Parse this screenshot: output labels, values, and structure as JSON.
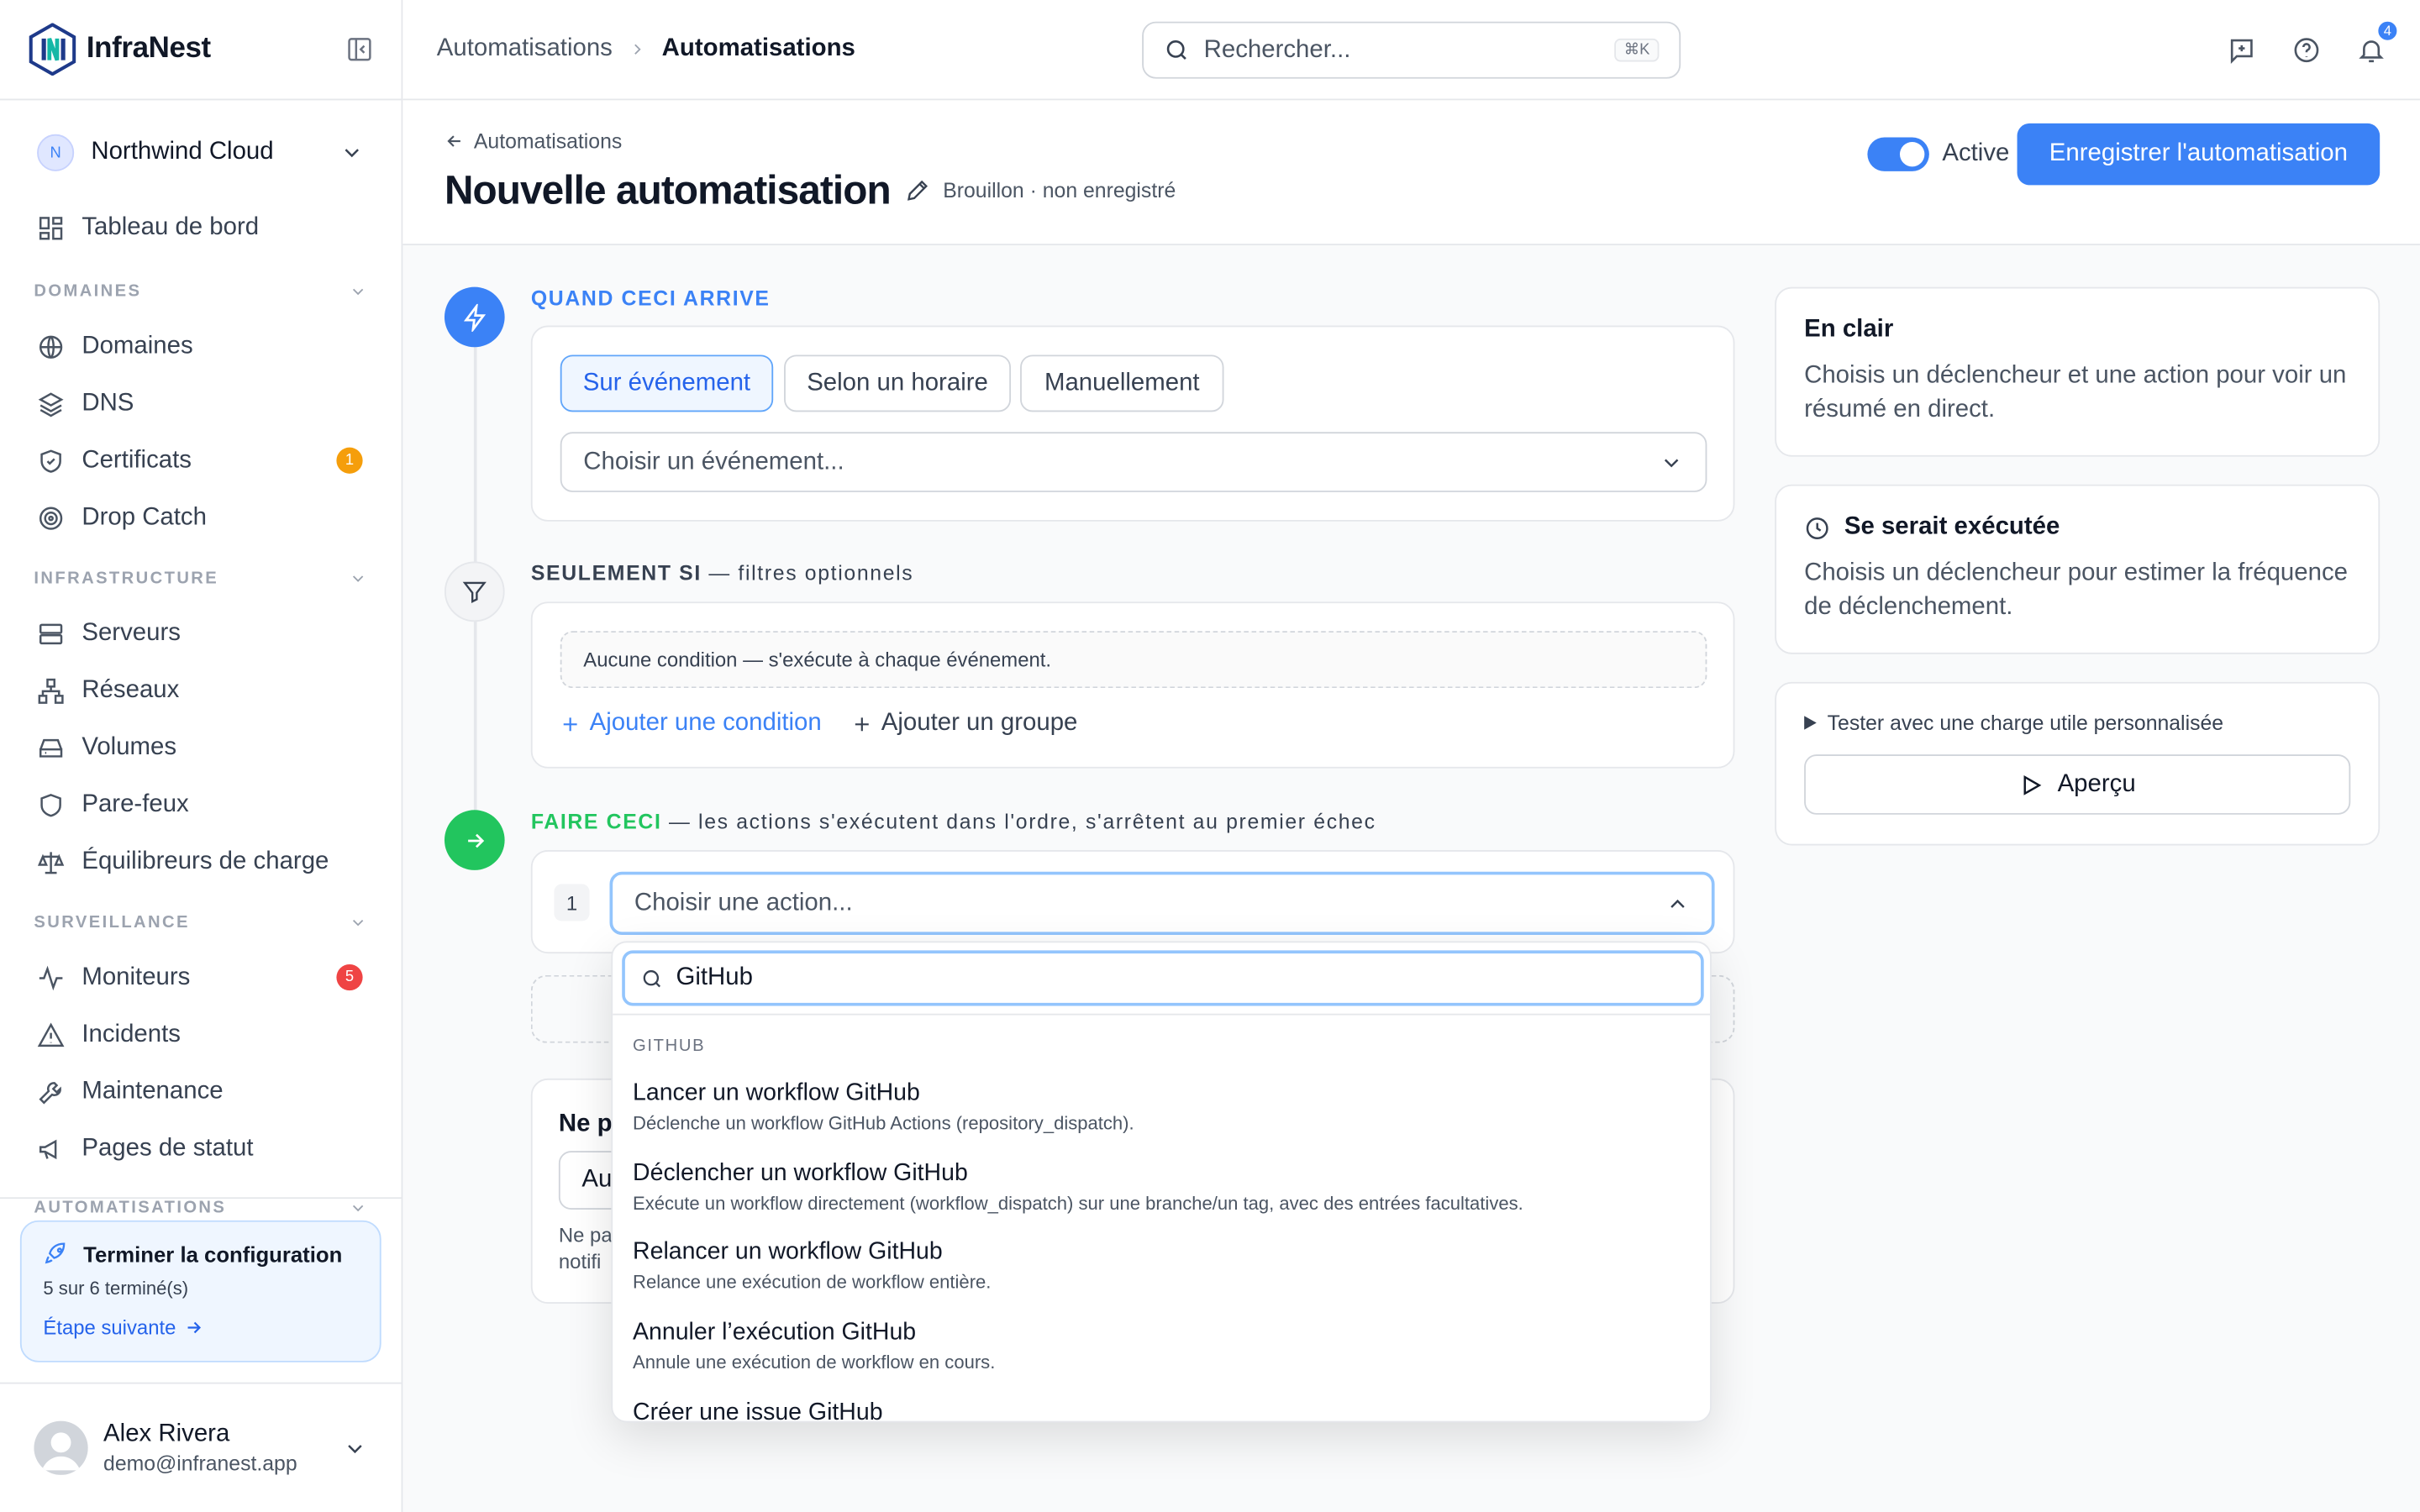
{
  "app": {
    "name": "InfraNest"
  },
  "org": {
    "initial": "N",
    "name": "Northwind Cloud"
  },
  "sidebar": {
    "dashboard": "Tableau de bord",
    "sections": {
      "domains": "DOMAINES",
      "infrastructure": "INFRASTRUCTURE",
      "monitoring": "SURVEILLANCE",
      "automations": "AUTOMATISATIONS"
    },
    "items": {
      "domains": "Domaines",
      "dns": "DNS",
      "certificates": "Certificats",
      "certificates_badge": "1",
      "drop_catch": "Drop Catch",
      "servers": "Serveurs",
      "networks": "Réseaux",
      "volumes": "Volumes",
      "firewalls": "Pare-feux",
      "load_balancers": "Équilibreurs de charge",
      "monitors": "Moniteurs",
      "monitors_badge": "5",
      "incidents": "Incidents",
      "maintenance": "Maintenance",
      "status_pages": "Pages de statut"
    },
    "badge_colors": {
      "certificates": "#f59e0b",
      "monitors": "#ef4444"
    }
  },
  "setup": {
    "title": "Terminer la configuration",
    "progress": "5 sur 6 terminé(s)",
    "next": "Étape suivante"
  },
  "user": {
    "name": "Alex Rivera",
    "email": "demo@infranest.app"
  },
  "topbar": {
    "breadcrumb_parent": "Automatisations",
    "breadcrumb_current": "Automatisations",
    "search_placeholder": "Rechercher...",
    "search_shortcut": "⌘K",
    "notifications_count": "4"
  },
  "header": {
    "back_label": "Automatisations",
    "title": "Nouvelle automatisation",
    "status": "Brouillon · non enregistré",
    "active_label": "Active",
    "active": true,
    "save_label": "Enregistrer l'automatisation"
  },
  "trigger": {
    "label": "QUAND CECI ARRIVE",
    "tabs": [
      "Sur événement",
      "Selon un horaire",
      "Manuellement"
    ],
    "active_tab": 0,
    "event_placeholder": "Choisir un événement..."
  },
  "filters": {
    "label_bold": "SEULEMENT SI",
    "label_rest": " — filtres optionnels",
    "empty": "Aucune condition — s'exécute à chaque événement.",
    "add_condition": "Ajouter une condition",
    "add_group": "Ajouter un groupe"
  },
  "actions": {
    "label_bold": "FAIRE CECI",
    "label_rest": " — les actions s'exécutent dans l'ordre, s'arrêtent au premier échec",
    "step_number": "1",
    "action_placeholder": "Choisir une action...",
    "hidden_card_title": "Ne p",
    "hidden_card_select": "Au",
    "hidden_card_text1": "Ne pa",
    "hidden_card_text2": "notifi"
  },
  "dropdown": {
    "search_value": "GitHub",
    "group": "GITHUB",
    "items": [
      {
        "title": "Lancer un workflow GitHub",
        "desc": "Déclenche un workflow GitHub Actions (repository_dispatch)."
      },
      {
        "title": "Déclencher un workflow GitHub",
        "desc": "Exécute un workflow directement (workflow_dispatch) sur une branche/un tag, avec des entrées facultatives."
      },
      {
        "title": "Relancer un workflow GitHub",
        "desc": "Relance une exécution de workflow entière."
      },
      {
        "title": "Annuler l’exécution GitHub",
        "desc": "Annule une exécution de workflow en cours."
      },
      {
        "title": "Créer une issue GitHub",
        "desc": ""
      }
    ]
  },
  "panel": {
    "plain_title": "En clair",
    "plain_text": "Choisis un déclencheur et une action pour voir un résumé en direct.",
    "would_run_title": "Se serait exécutée",
    "would_run_text": "Choisis un déclencheur pour estimer la fréquence de déclenchement.",
    "test_label": "Tester avec une charge utile personnalisée",
    "preview_label": "Aperçu"
  },
  "colors": {
    "accent": "#3b82f6",
    "success": "#22c55e"
  }
}
